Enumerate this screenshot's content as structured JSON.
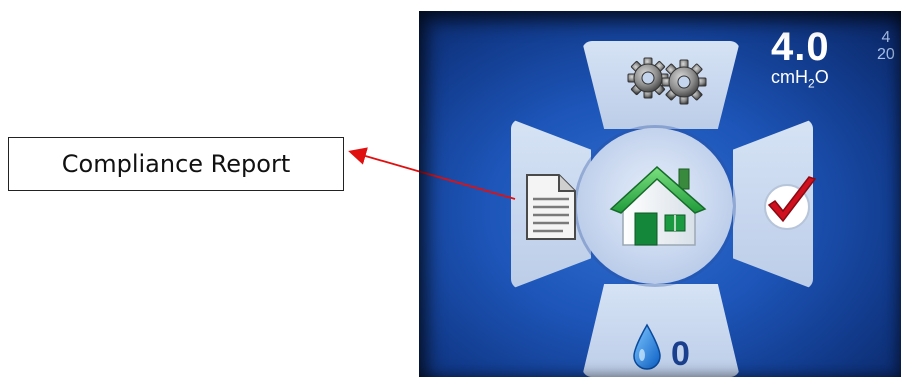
{
  "callout": {
    "label": "Compliance Report"
  },
  "screen": {
    "pressure_value": "4.0",
    "pressure_unit_main": "cmH",
    "pressure_unit_sub": "2",
    "pressure_unit_tail": "O",
    "side_top": "4",
    "side_bottom": "20",
    "humidity_level": "0"
  },
  "icons": {
    "top": "gears-icon",
    "left": "document-icon",
    "center": "home-icon",
    "right": "checkmark-icon",
    "bottom": "water-drop-icon"
  },
  "colors": {
    "arrow": "#e01010",
    "screen_blue": "#1d55b8",
    "panel": "#c9d8ef",
    "home_green": "#2bb24c",
    "check_red": "#d0101e"
  }
}
